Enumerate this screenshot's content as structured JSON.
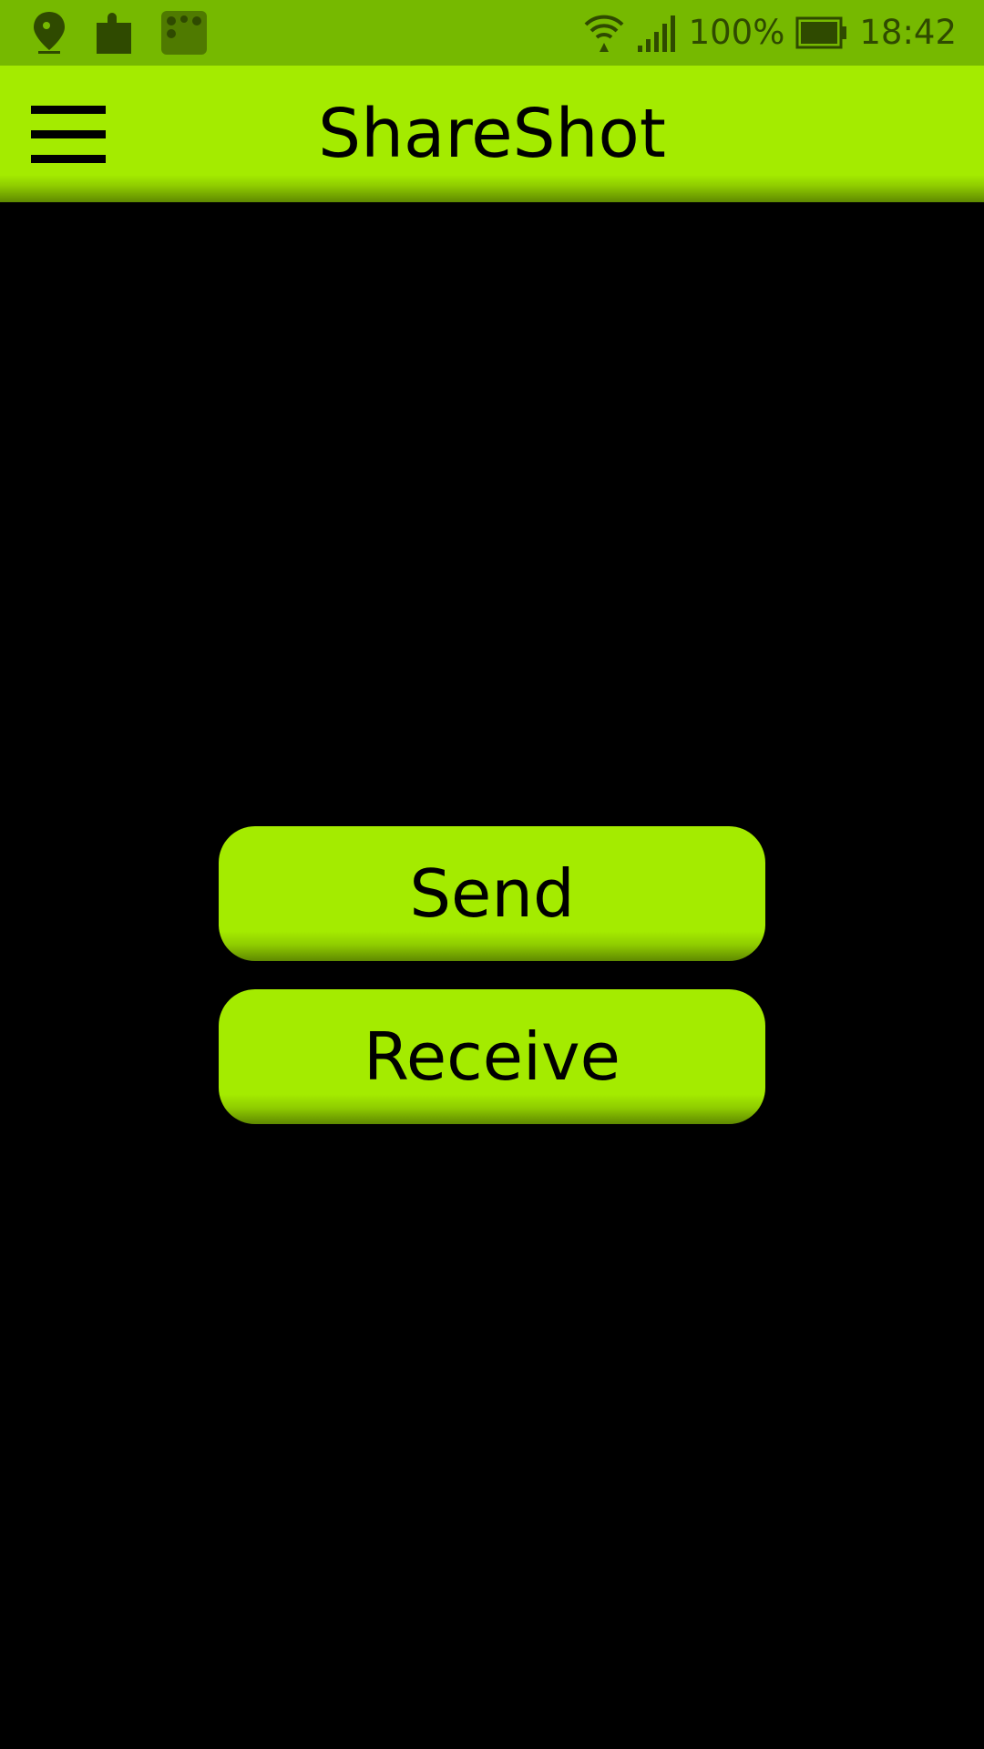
{
  "status_bar": {
    "battery": "100%",
    "time": "18:42",
    "icons": [
      "location-pin-icon",
      "puzzle-icon",
      "group-icon",
      "wifi-icon",
      "signal-icon",
      "battery-icon"
    ],
    "colors": {
      "background": "#76b900",
      "icon": "#2f4a00"
    }
  },
  "app_bar": {
    "title": "ShareShot",
    "menu_icon": "hamburger-menu-icon",
    "color": "#a4eb00"
  },
  "buttons": {
    "send_label": "Send",
    "receive_label": "Receive",
    "color": "#a4eb00"
  }
}
